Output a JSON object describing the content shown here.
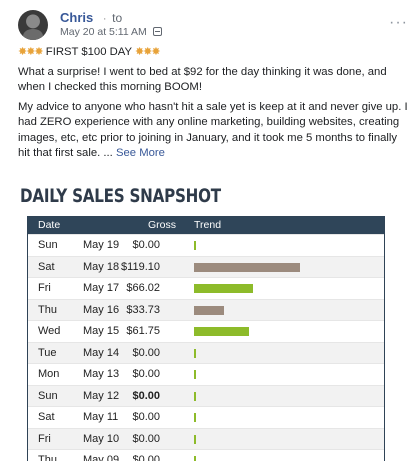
{
  "post": {
    "author": "Chris",
    "author_separator": "·",
    "to_label": "to",
    "timestamp": "May 20 at 5:11 AM",
    "headline": "FIRST $100 DAY",
    "paragraph1": "What a surprise! I went to bed at $92 for the day thinking it was done, and when I checked this morning BOOM!",
    "paragraph2": "My advice to anyone who hasn't hit a sale yet is keep at it and never give up. I had ZERO experience with any online marketing, building websites, creating images, etc, etc prior to joining in January, and it took me 5 months to finally hit that first sale. ...",
    "see_more": "See More",
    "icons": {
      "privacy": "globe-icon",
      "more": "more-options-icon",
      "emoji": "sparkle-emoji"
    }
  },
  "snapshot": {
    "title": "DAILY SALES SNAPSHOT",
    "columns": {
      "date": "Date",
      "gross": "Gross",
      "trend": "Trend"
    }
  },
  "colors": {
    "header_bg": "#2f4559",
    "trend_positive_high": "#9c8b7e",
    "trend_positive": "#8dbb2a",
    "trend_mid": "#9c8b7e",
    "trend_zero": "#8dbb2a"
  },
  "chart_data": {
    "type": "table",
    "title": "DAILY SALES SNAPSHOT",
    "columns": [
      "Date",
      "Gross",
      "Trend"
    ],
    "rows": [
      {
        "day": "Sun",
        "date": "May 19",
        "gross": "$0.00",
        "value": 0,
        "bar_color": "#8dbb2a"
      },
      {
        "day": "Sat",
        "date": "May 18",
        "gross": "$119.10",
        "value": 119.1,
        "bar_color": "#9c8b7e"
      },
      {
        "day": "Fri",
        "date": "May 17",
        "gross": "$66.02",
        "value": 66.02,
        "bar_color": "#8dbb2a"
      },
      {
        "day": "Thu",
        "date": "May 16",
        "gross": "$33.73",
        "value": 33.73,
        "bar_color": "#9c8b7e"
      },
      {
        "day": "Wed",
        "date": "May 15",
        "gross": "$61.75",
        "value": 61.75,
        "bar_color": "#8dbb2a"
      },
      {
        "day": "Tue",
        "date": "May 14",
        "gross": "$0.00",
        "value": 0,
        "bar_color": "#8dbb2a"
      },
      {
        "day": "Mon",
        "date": "May 13",
        "gross": "$0.00",
        "value": 0,
        "bar_color": "#8dbb2a"
      },
      {
        "day": "Sun",
        "date": "May 12",
        "gross": "$0.00",
        "value": 0,
        "bar_color": "#8dbb2a"
      },
      {
        "day": "Sat",
        "date": "May 11",
        "gross": "$0.00",
        "value": 0,
        "bar_color": "#8dbb2a"
      },
      {
        "day": "Fri",
        "date": "May 10",
        "gross": "$0.00",
        "value": 0,
        "bar_color": "#8dbb2a"
      },
      {
        "day": "Thu",
        "date": "May 09",
        "gross": "$0.00",
        "value": 0,
        "bar_color": "#8dbb2a"
      }
    ],
    "value_max": 119.1
  }
}
